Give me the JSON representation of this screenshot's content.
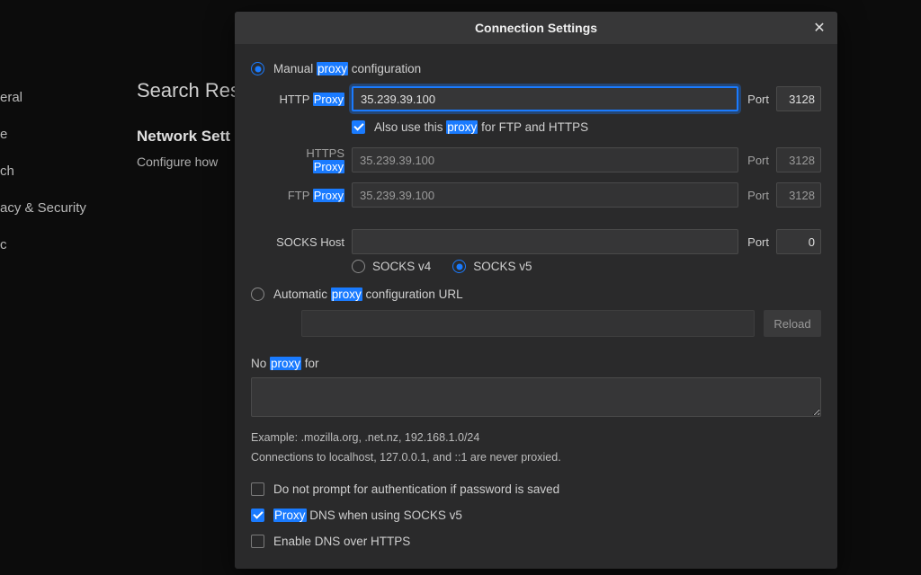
{
  "sidebar": {
    "items": [
      {
        "label": "eral"
      },
      {
        "label": "e"
      },
      {
        "label": "ch"
      },
      {
        "label": "acy & Security"
      },
      {
        "label": "c"
      }
    ]
  },
  "main": {
    "search_heading": "Search Res",
    "section_title": "Network Sett",
    "section_sub": "Configure how"
  },
  "modal": {
    "title": "Connection Settings",
    "manual_prefix": "Manual ",
    "manual_hl": "proxy",
    "manual_suffix": " configuration",
    "http_label_prefix": "HTTP ",
    "http_label_hl": "Proxy",
    "http_value": "35.239.39.100",
    "port_label": "Port",
    "http_port": "3128",
    "also_prefix": "Also use this ",
    "also_hl": "proxy",
    "also_suffix": " for FTP and HTTPS",
    "https_label_prefix": "HTTPS ",
    "https_label_hl": "Proxy",
    "https_value": "35.239.39.100",
    "https_port": "3128",
    "ftp_label_prefix": "FTP ",
    "ftp_label_hl": "Proxy",
    "ftp_value": "35.239.39.100",
    "ftp_port": "3128",
    "socks_label": "SOCKS Host",
    "socks_value": "",
    "socks_port": "0",
    "socks_v4": "SOCKS v4",
    "socks_v5": "SOCKS v5",
    "auto_prefix": "Automatic ",
    "auto_hl": "proxy",
    "auto_suffix": " configuration URL",
    "reload": "Reload",
    "no_proxy_prefix": "No ",
    "no_proxy_hl": "proxy",
    "no_proxy_suffix": " for",
    "hint1": "Example: .mozilla.org, .net.nz, 192.168.1.0/24",
    "hint2": "Connections to localhost, 127.0.0.1, and ::1 are never proxied.",
    "cb_noauth": "Do not prompt for authentication if password is saved",
    "cb_dns_hl": "Proxy",
    "cb_dns_suffix": " DNS when using SOCKS v5",
    "cb_doh": "Enable DNS over HTTPS"
  }
}
